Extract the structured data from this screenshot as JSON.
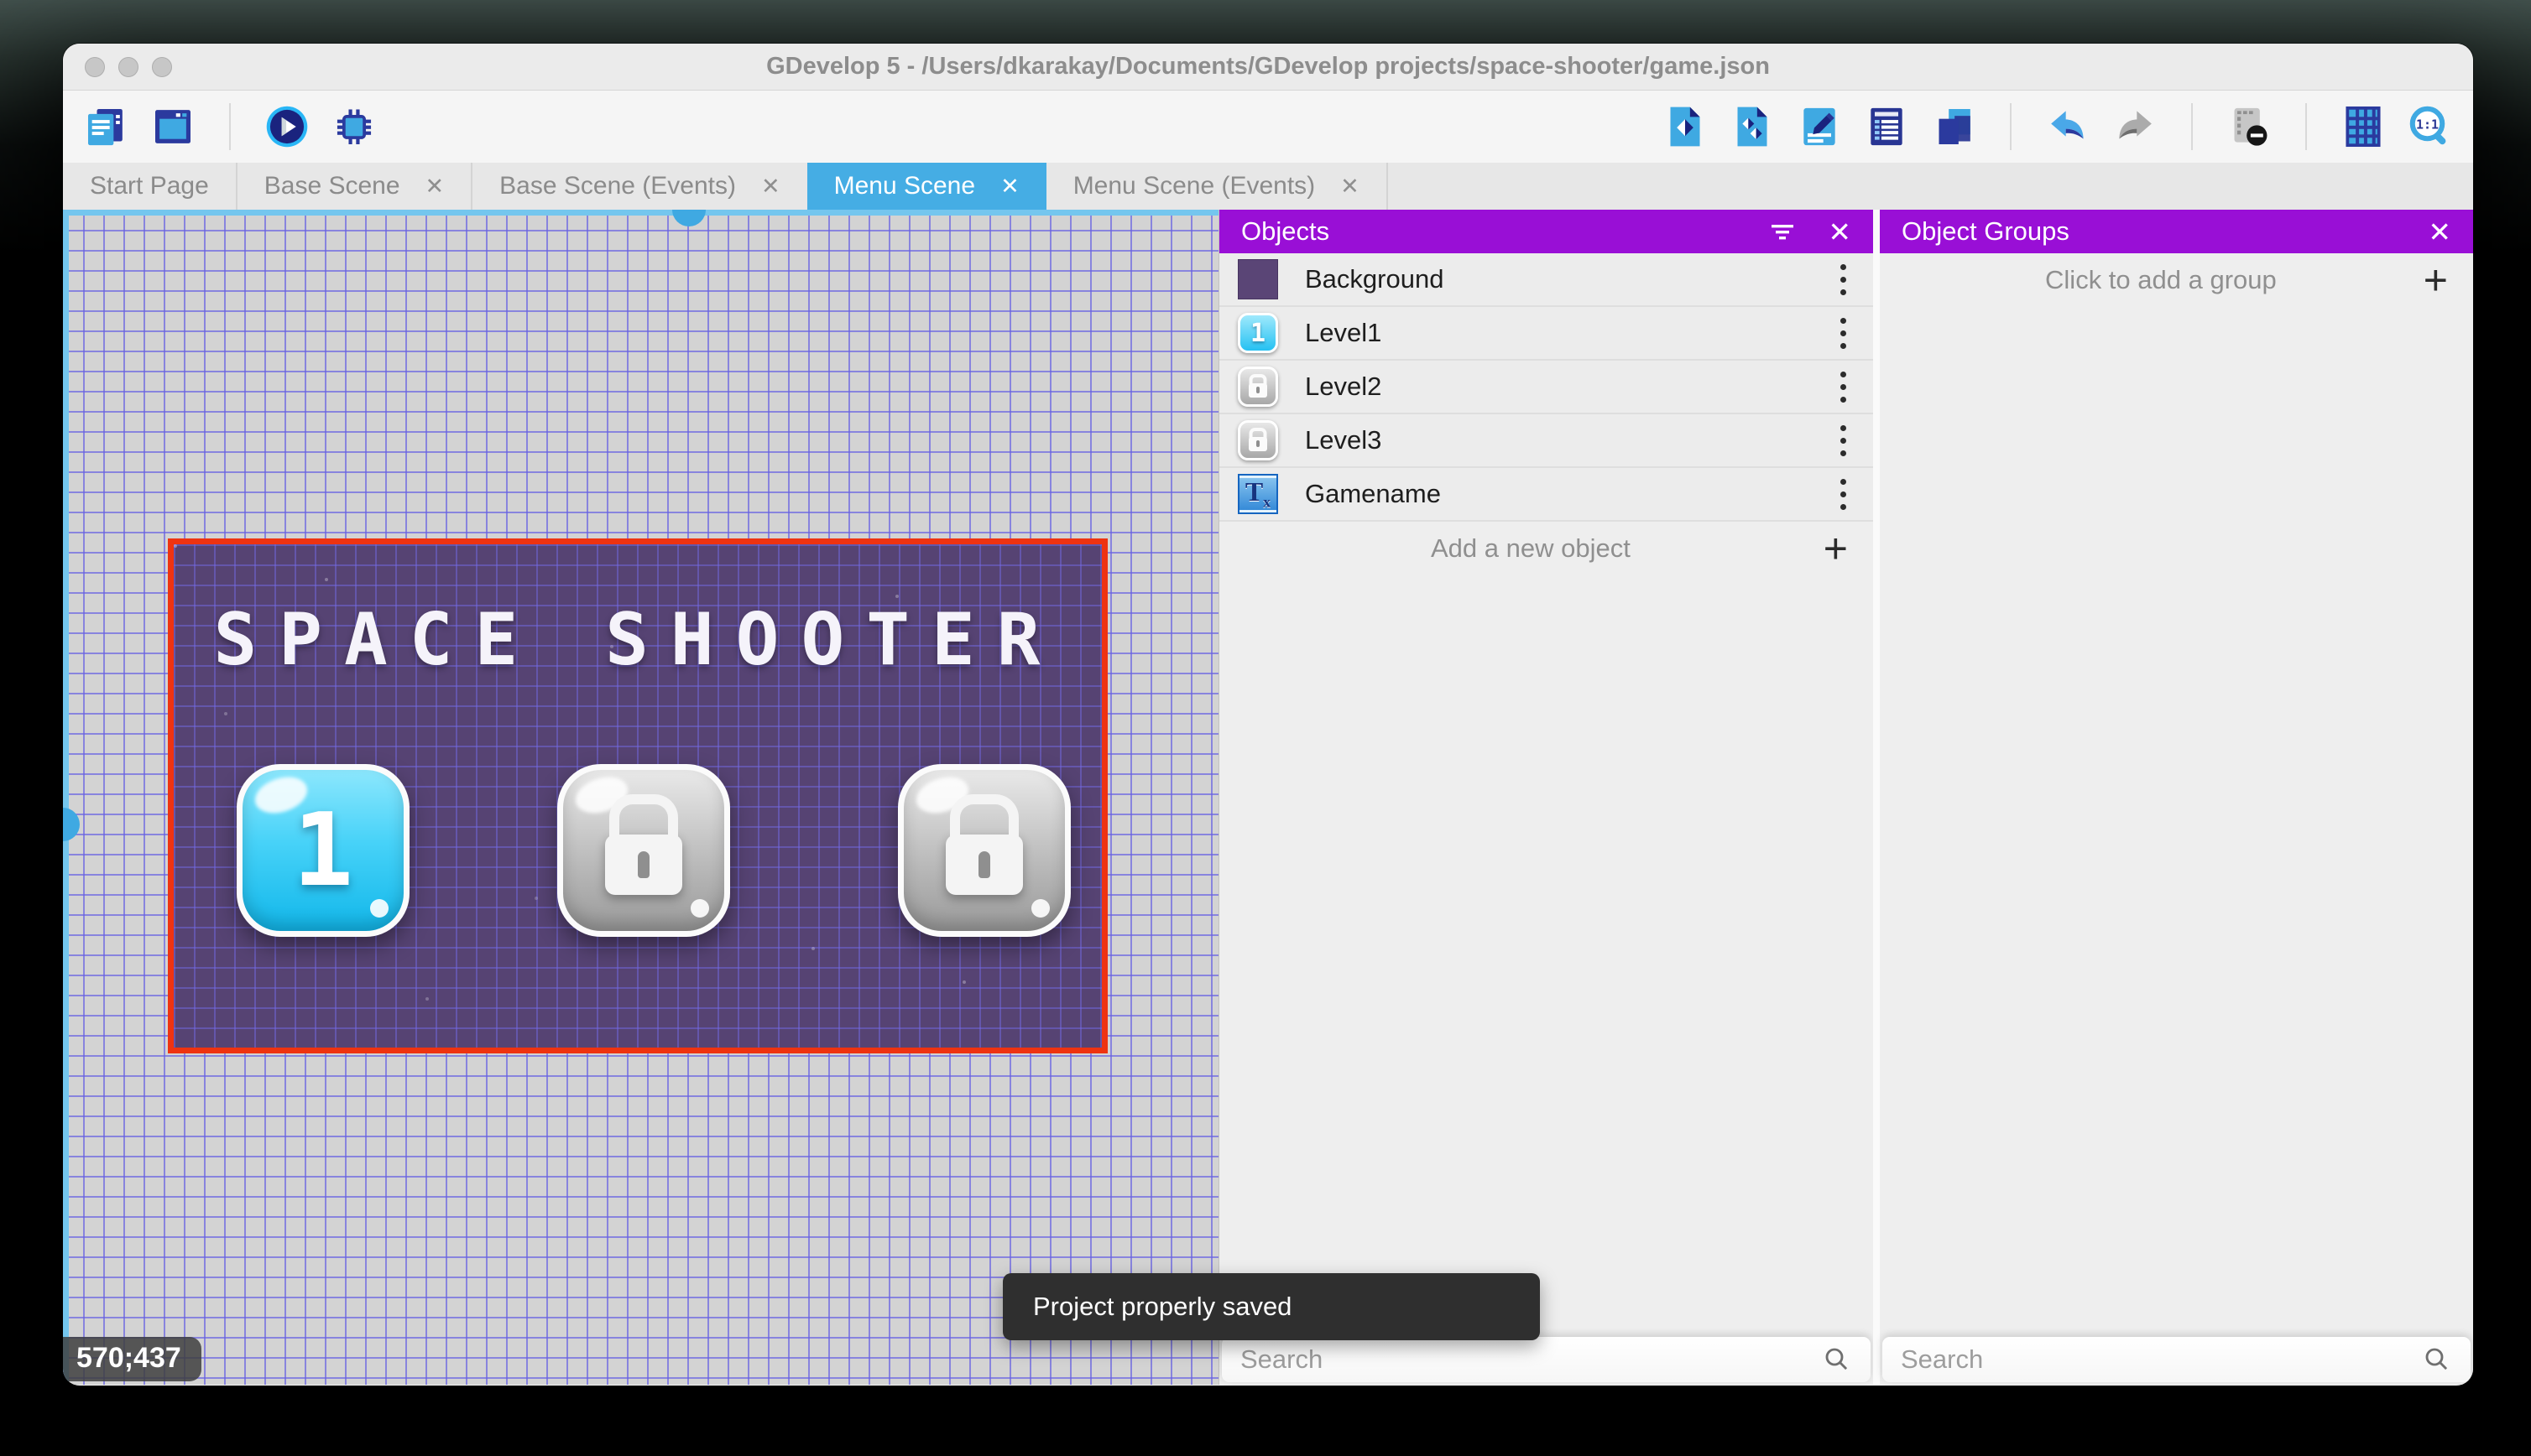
{
  "window": {
    "title": "GDevelop 5 - /Users/dkarakay/Documents/GDevelop projects/space-shooter/game.json"
  },
  "toolbar": {
    "left_icons": [
      "project-manager-icon",
      "preview-window-icon",
      "play-preview-icon",
      "debug-icon"
    ],
    "right_icons": [
      "objects-editor-icon",
      "instances-list-icon",
      "scene-properties-icon",
      "layers-icon",
      "deep-copy-icon",
      "undo-icon",
      "redo-icon",
      "render-mask-icon",
      "grid-icon",
      "zoom-original-icon"
    ]
  },
  "tabs": [
    {
      "label": "Start Page",
      "closable": false,
      "active": false
    },
    {
      "label": "Base Scene",
      "closable": true,
      "active": false
    },
    {
      "label": "Base Scene (Events)",
      "closable": true,
      "active": false
    },
    {
      "label": "Menu Scene",
      "closable": true,
      "active": true
    },
    {
      "label": "Menu Scene (Events)",
      "closable": true,
      "active": false
    }
  ],
  "canvas": {
    "coordinates_label": "570;437",
    "scene": {
      "title": "SPACE SHOOTER",
      "buttons": [
        {
          "label": "1",
          "state": "unlocked"
        },
        {
          "label": "",
          "state": "locked"
        },
        {
          "label": "",
          "state": "locked"
        }
      ]
    }
  },
  "toast": {
    "message": "Project properly saved"
  },
  "objects_panel": {
    "title": "Objects",
    "items": [
      {
        "name": "Background",
        "thumb": "purple-square"
      },
      {
        "name": "Level1",
        "thumb": "cyan-button",
        "thumb_label": "1"
      },
      {
        "name": "Level2",
        "thumb": "lock-button"
      },
      {
        "name": "Level3",
        "thumb": "lock-button"
      },
      {
        "name": "Gamename",
        "thumb": "text-object"
      }
    ],
    "add_label": "Add a new object",
    "search_placeholder": "Search"
  },
  "object_groups_panel": {
    "title": "Object Groups",
    "add_label": "Click to add a group",
    "search_placeholder": "Search"
  },
  "icons": {
    "close_glyph": "✕",
    "plus_glyph": "+",
    "text_thumb_glyph": "T",
    "text_thumb_sub_glyph": "x"
  },
  "colors": {
    "panel_header_purple": "#990fd6",
    "active_tab_blue": "#45ade4",
    "scene_border_red": "#ee3311",
    "scene_background": "#564373",
    "unlocked_button_cyan": "#12b7ea",
    "grid_line": "#6862e2"
  }
}
